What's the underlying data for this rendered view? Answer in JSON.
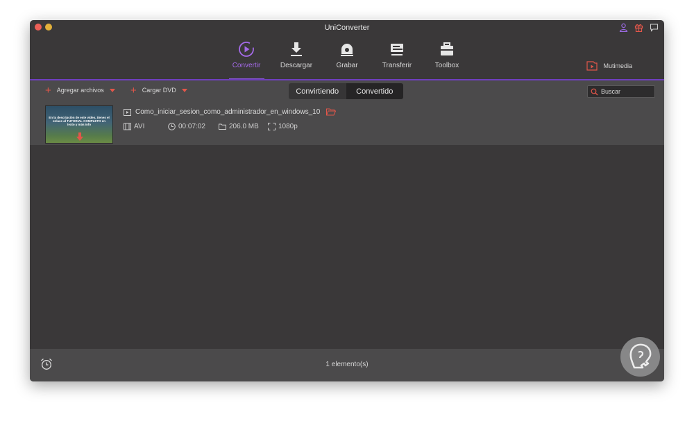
{
  "window": {
    "title": "UniConverter"
  },
  "nav": {
    "items": [
      {
        "label": "Convertir",
        "icon": "convert-icon",
        "active": true
      },
      {
        "label": "Descargar",
        "icon": "download-icon"
      },
      {
        "label": "Grabar",
        "icon": "burn-icon"
      },
      {
        "label": "Transferir",
        "icon": "transfer-icon"
      },
      {
        "label": "Toolbox",
        "icon": "toolbox-icon"
      }
    ],
    "multimedia_label": "Mutimedia"
  },
  "toolbar": {
    "add_files_label": "Agregar archivos",
    "load_dvd_label": "Cargar DVD",
    "tabs": [
      "Convirtiendo",
      "Convertido"
    ],
    "selected_tab": "Convertido",
    "search_placeholder": "Buscar"
  },
  "file": {
    "name": "Como_iniciar_sesion_como_administrador_en_windows_10",
    "thumbnail_text": "En la descripción de este video, tienes el enlace al TUTORIAL COMPLETO en texto y más info",
    "format": "AVI",
    "duration": "00:07:02",
    "size": "206.0 MB",
    "resolution": "1080p"
  },
  "status": {
    "count_label": "1 elemento(s)"
  },
  "colors": {
    "accent": "#8a55d8",
    "red": "#e2564a",
    "bg": "#3a3839",
    "panel": "#4b4a4b"
  }
}
